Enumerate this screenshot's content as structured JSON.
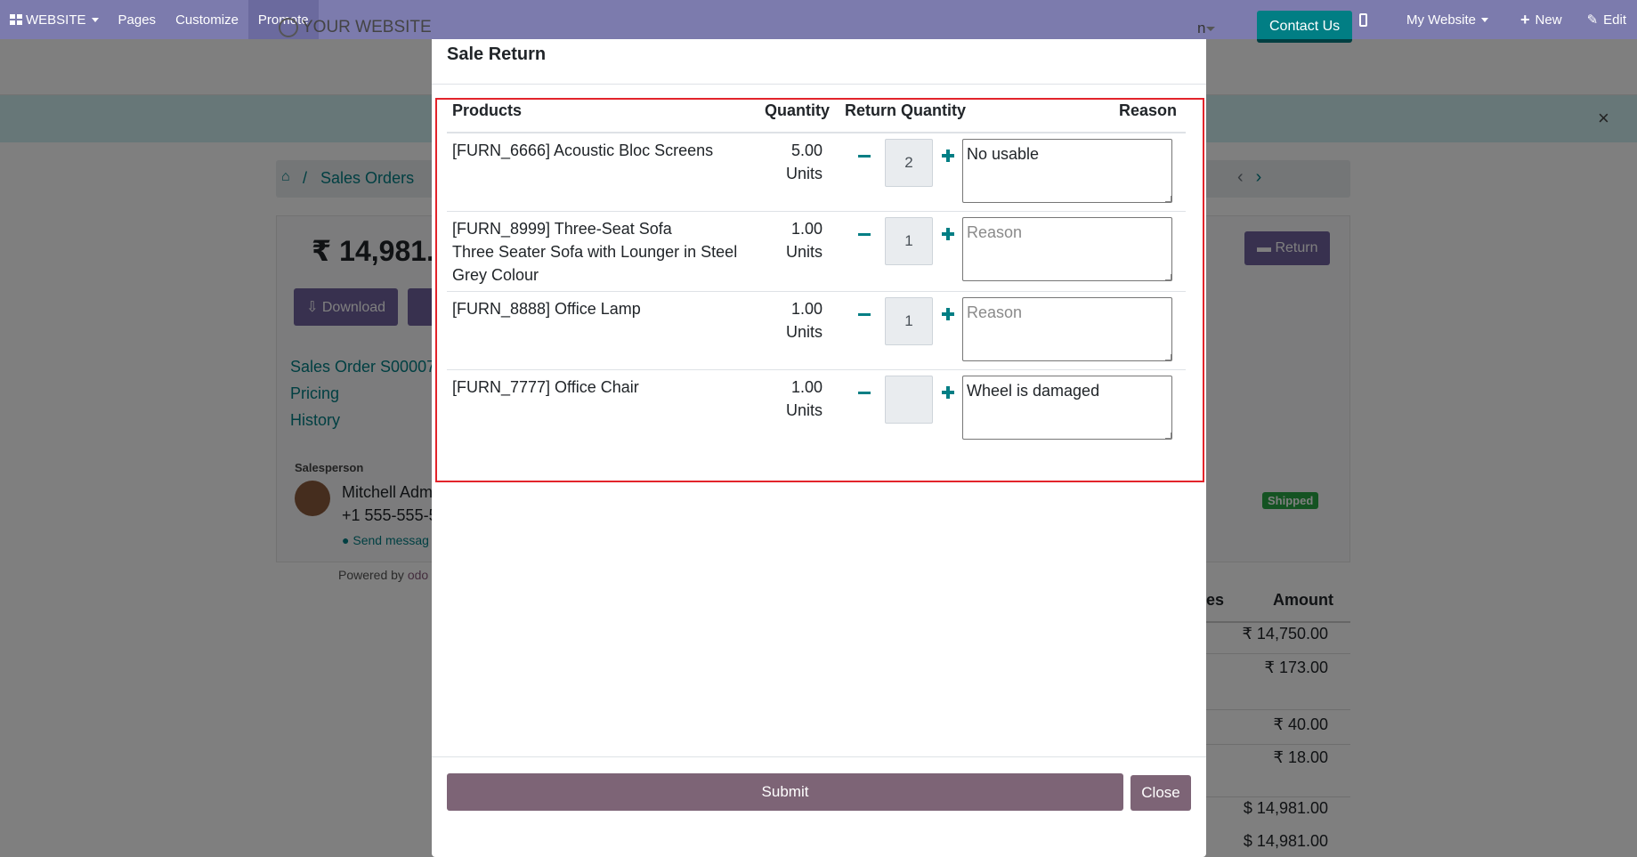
{
  "topbar": {
    "website_label": "WEBSITE",
    "pages_label": "Pages",
    "customize_label": "Customize",
    "promote_label": "Promote",
    "my_website_label": "My Website",
    "new_label": "New",
    "edit_label": "Edit",
    "bar_color": "#7c7bad"
  },
  "site": {
    "logo_text": "YOUR WEBSITE",
    "menu_fragment": "n",
    "contact_label": "Contact Us",
    "close_glyph": "×",
    "breadcrumb_sales_orders": "Sales Orders",
    "breadcrumb_separator": "/",
    "amount_fragment": "₹ 14,981.",
    "return_label": "Return",
    "download_label": "Download",
    "links": [
      "Sales Order S00007",
      "Pricing",
      "History"
    ],
    "salesperson_label": "Salesperson",
    "salesperson_name": "Mitchell Adm",
    "salesperson_phone": "+1 555-555-5",
    "send_message_label": "Send messag",
    "powered_by_label": "Powered by",
    "powered_brand_fragment": "odo",
    "shipped_badge": "Shipped",
    "table_header_fragment": "es",
    "table_header_amount": "Amount",
    "amounts": [
      "₹ 14,750.00",
      "₹ 173.00",
      "₹ 40.00",
      "₹ 18.00",
      "$ 14,981.00",
      "$ 14,981.00"
    ]
  },
  "modal": {
    "title": "Sale Return",
    "columns": {
      "products": "Products",
      "quantity": "Quantity",
      "return_quantity": "Return Quantity",
      "reason": "Reason"
    },
    "rows": [
      {
        "product": "[FURN_6666] Acoustic Bloc Screens",
        "qty": "5.00",
        "uom": "Units",
        "return_qty": "2",
        "reason_value": "No usable",
        "reason_placeholder": "Reason"
      },
      {
        "product": "[FURN_8999] Three-Seat Sofa\nThree Seater Sofa with Lounger in Steel Grey Colour",
        "qty": "1.00",
        "uom": "Units",
        "return_qty": "1",
        "reason_value": "",
        "reason_placeholder": "Reason"
      },
      {
        "product": "[FURN_8888] Office Lamp",
        "qty": "1.00",
        "uom": "Units",
        "return_qty": "1",
        "reason_value": "",
        "reason_placeholder": "Reason"
      },
      {
        "product": "[FURN_7777] Office Chair",
        "qty": "1.00",
        "uom": "Units",
        "return_qty": "",
        "reason_value": "Wheel is damaged",
        "reason_placeholder": "Reason"
      }
    ],
    "submit_label": "Submit",
    "close_label": "Close",
    "highlight_color": "#e3242b",
    "button_color": "#7d6476",
    "accent_color": "#017e84"
  }
}
